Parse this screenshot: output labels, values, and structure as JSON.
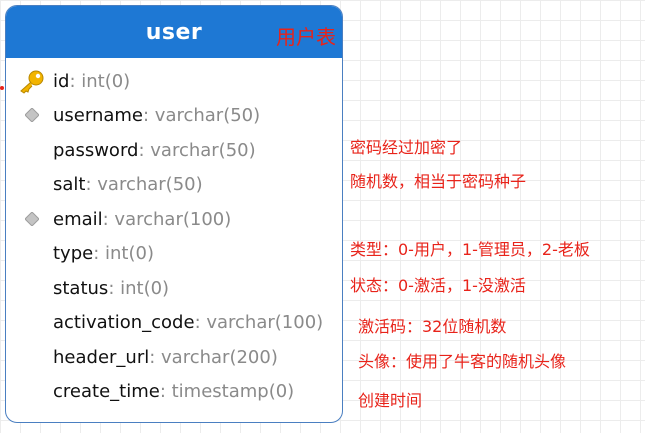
{
  "table": {
    "title": "user",
    "note": "用户表",
    "fields": [
      {
        "name": "id",
        "type": ": int(0)",
        "icon": "key-icon"
      },
      {
        "name": "username",
        "type": ": varchar(50)",
        "icon": "diamond-icon"
      },
      {
        "name": "password",
        "type": ": varchar(50)",
        "icon": ""
      },
      {
        "name": "salt",
        "type": ": varchar(50)",
        "icon": ""
      },
      {
        "name": "email",
        "type": ": varchar(100)",
        "icon": "diamond-icon"
      },
      {
        "name": "type",
        "type": ": int(0)",
        "icon": ""
      },
      {
        "name": "status",
        "type": ": int(0)",
        "icon": ""
      },
      {
        "name": "activation_code",
        "type": ": varchar(100)",
        "icon": ""
      },
      {
        "name": "header_url",
        "type": ": varchar(200)",
        "icon": ""
      },
      {
        "name": "create_time",
        "type": ": timestamp(0)",
        "icon": ""
      }
    ]
  },
  "notes": {
    "password": "密码经过加密了",
    "salt": "随机数，相当于密码种子",
    "type": "类型：0-用户，1-管理员，2-老板",
    "status": "状态：0-激活，1-没激活",
    "activation_code": "激活码：32位随机数",
    "header_url": "头像：使用了牛客的随机头像",
    "create_time": "创建时间"
  },
  "colors": {
    "header": "#1e78d4",
    "border": "#4a7fc1",
    "annotation": "#e8231a",
    "field_type": "#8a8a8a",
    "key": "#f2b400",
    "diamond": "#bdbdbd"
  }
}
